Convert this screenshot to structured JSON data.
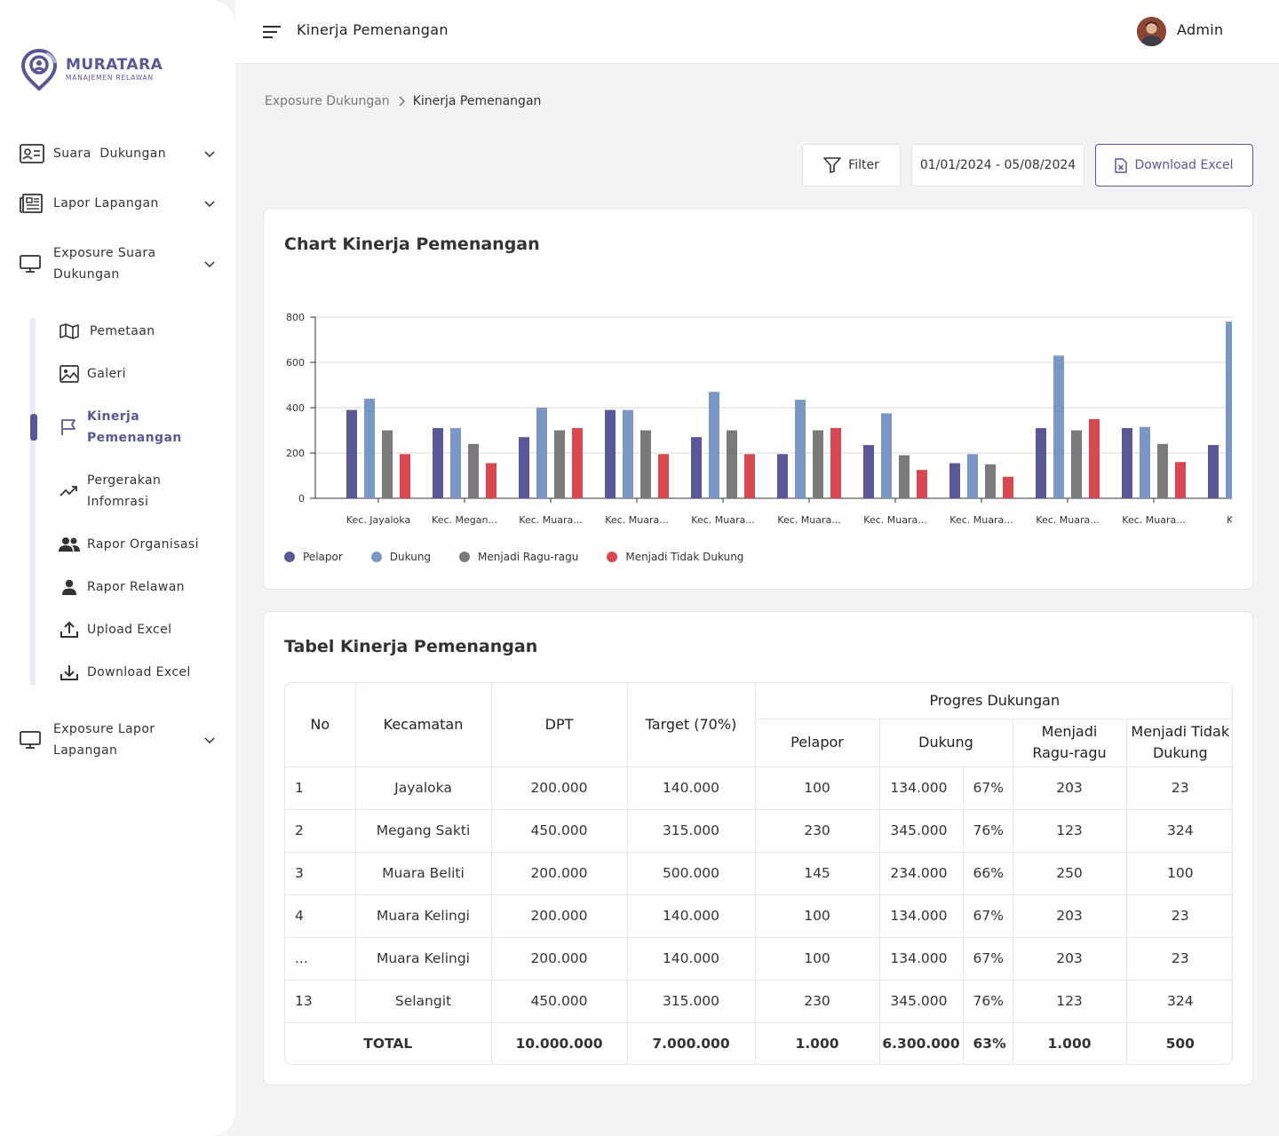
{
  "brand": {
    "name": "MURATARA",
    "tagline": "MANAJEMEN RELAWAN"
  },
  "sidebar": {
    "items": [
      {
        "label": "Suara  Dukungan",
        "icon": "id-card-icon"
      },
      {
        "label": "Lapor Lapangan",
        "icon": "newspaper-icon"
      },
      {
        "label": "Exposure Suara Dukungan",
        "icon": "monitor-icon"
      },
      {
        "label": "Exposure Lapor Lapangan",
        "icon": "monitor-icon"
      }
    ],
    "subitems": [
      {
        "label": "Pemetaan",
        "icon": "map-icon"
      },
      {
        "label": "Galeri",
        "icon": "image-icon"
      },
      {
        "label": "Kinerja Pemenangan",
        "icon": "flag-icon",
        "active": true
      },
      {
        "label": "Pergerakan Infomrasi",
        "icon": "trend-icon"
      },
      {
        "label": "Rapor Organisasi",
        "icon": "group-icon"
      },
      {
        "label": "Rapor Relawan",
        "icon": "user-icon"
      },
      {
        "label": "Upload Excel",
        "icon": "upload-icon"
      },
      {
        "label": "Download Excel",
        "icon": "download-icon"
      }
    ]
  },
  "header": {
    "title": "Kinerja Pemenangan",
    "user": "Admin"
  },
  "breadcrumb": {
    "parent": "Exposure Dukungan",
    "current": "Kinerja Pemenangan"
  },
  "toolbar": {
    "filter_label": "Filter",
    "date_range": "01/01/2024 - 05/08/2024",
    "download_label": "Download Excel"
  },
  "colors": {
    "accent": "#5a5796",
    "pelapor": "#5a5796",
    "dukung": "#7b97c6",
    "ragu": "#7a7a7a",
    "tidak": "#d9484e"
  },
  "chart_title": "Chart Kinerja Pemenangan",
  "chart_data": {
    "type": "bar",
    "ylim": [
      0,
      800
    ],
    "yticks": [
      0,
      200,
      400,
      600,
      800
    ],
    "categories": [
      "Kec. Jayaloka",
      "Kec. Megan...",
      "Kec. Muara...",
      "Kec. Muara...",
      "Kec. Muara...",
      "Kec. Muara...",
      "Kec. Muara...",
      "Kec. Muara...",
      "Kec. Muara...",
      "Kec. Muara...",
      "Kec. I"
    ],
    "series": [
      {
        "name": "Pelapor",
        "color": "#5a5796",
        "values": [
          390,
          310,
          270,
          390,
          270,
          195,
          235,
          155,
          310,
          310,
          235
        ]
      },
      {
        "name": "Dukung",
        "color": "#7b97c6",
        "values": [
          440,
          310,
          400,
          390,
          470,
          435,
          375,
          195,
          630,
          315,
          780
        ]
      },
      {
        "name": "Menjadi Ragu-ragu",
        "color": "#7a7a7a",
        "values": [
          300,
          240,
          300,
          300,
          300,
          300,
          190,
          150,
          300,
          240,
          null
        ]
      },
      {
        "name": "Menjadi Tidak Dukung",
        "color": "#d9484e",
        "values": [
          195,
          155,
          310,
          195,
          195,
          310,
          125,
          95,
          350,
          160,
          null
        ]
      }
    ]
  },
  "table_title": "Tabel Kinerja Pemenangan",
  "table": {
    "headers": {
      "no": "No",
      "kecamatan": "Kecamatan",
      "dpt": "DPT",
      "target": "Target (70%)",
      "group": "Progres Dukungan",
      "pelapor": "Pelapor",
      "dukung": "Dukung",
      "ragu": "Menjadi Ragu-ragu",
      "tidak": "Menjadi Tidak Dukung"
    },
    "rows": [
      [
        "1",
        "Jayaloka",
        "200.000",
        "140.000",
        "100",
        "134.000",
        "67%",
        "203",
        "23"
      ],
      [
        "2",
        "Megang Sakti",
        "450.000",
        "315.000",
        "230",
        "345.000",
        "76%",
        "123",
        "324"
      ],
      [
        "3",
        "Muara Beliti",
        "200.000",
        "500.000",
        "145",
        "234.000",
        "66%",
        "250",
        "100"
      ],
      [
        "4",
        "Muara Kelingi",
        "200.000",
        "140.000",
        "100",
        "134.000",
        "67%",
        "203",
        "23"
      ],
      [
        "...",
        "Muara Kelingi",
        "200.000",
        "140.000",
        "100",
        "134.000",
        "67%",
        "203",
        "23"
      ],
      [
        "13",
        "Selangit",
        "450.000",
        "315.000",
        "230",
        "345.000",
        "76%",
        "123",
        "324"
      ]
    ],
    "total": [
      "TOTAL",
      "10.000.000",
      "7.000.000",
      "1.000",
      "6.300.000",
      "63%",
      "1.000",
      "500"
    ]
  }
}
